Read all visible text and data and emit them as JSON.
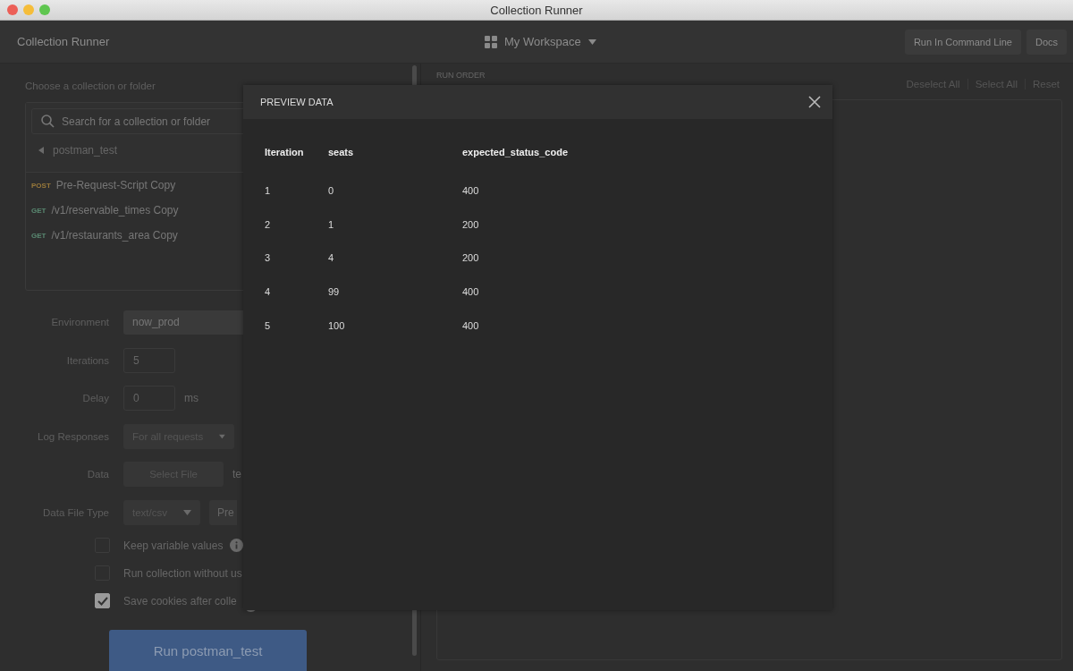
{
  "window": {
    "title": "Collection Runner"
  },
  "header": {
    "title": "Collection Runner",
    "workspace": "My Workspace",
    "buttons": [
      "Run In Command Line",
      "Docs"
    ]
  },
  "left": {
    "choose_label": "Choose a collection or folder",
    "search": {
      "placeholder": "Search for a collection or folder"
    },
    "collection": "postman_test",
    "requests": [
      {
        "method": "POST",
        "name": "Pre-Request-Script Copy",
        "color": "#98783a"
      },
      {
        "method": "GET",
        "name": "/v1/reservable_times Copy",
        "color": "#5a8a72"
      },
      {
        "method": "GET",
        "name": "/v1/restaurants_area Copy",
        "color": "#5a8a72"
      }
    ],
    "fields": [
      {
        "kind": "select",
        "label": "Environment",
        "value": "now_prod"
      },
      {
        "kind": "number",
        "label": "Iterations",
        "value": "5"
      },
      {
        "kind": "number",
        "label": "Delay",
        "value": "0",
        "unit": "ms"
      },
      {
        "kind": "dropdown",
        "label": "Log Responses",
        "value": "For all requests"
      },
      {
        "kind": "file",
        "label": "Data",
        "value": "Select File",
        "unit": "te"
      },
      {
        "kind": "filetype",
        "label": "Data File Type",
        "value": "text/csv",
        "extra": "Pre"
      }
    ],
    "options": [
      {
        "label": "Keep variable values",
        "checked": false,
        "info": true
      },
      {
        "label": "Run collection without us",
        "checked": false,
        "info": false
      },
      {
        "label": "Save cookies after colle",
        "checked": true,
        "info": true
      }
    ],
    "run_button": "Run postman_test"
  },
  "run_order": {
    "title": "RUN ORDER",
    "actions": [
      "Deselect All",
      "Select All",
      "Reset"
    ]
  },
  "preview": {
    "title": "PREVIEW DATA",
    "columns": [
      "Iteration",
      "seats",
      "expected_status_code"
    ],
    "rows": [
      [
        "1",
        "0",
        "400"
      ],
      [
        "2",
        "1",
        "200"
      ],
      [
        "3",
        "4",
        "200"
      ],
      [
        "4",
        "99",
        "400"
      ],
      [
        "5",
        "100",
        "400"
      ]
    ]
  }
}
